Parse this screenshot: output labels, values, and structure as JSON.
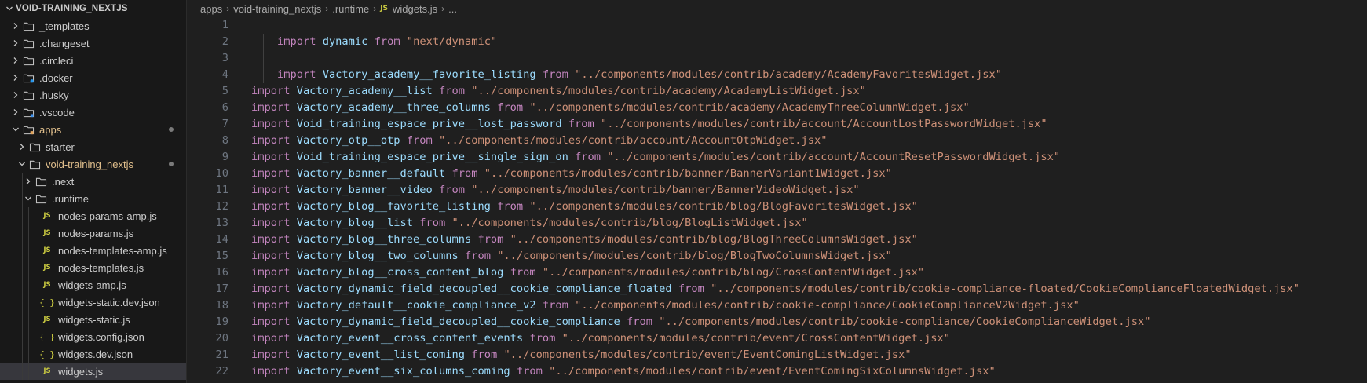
{
  "sidebar": {
    "root_label": "VOID-TRAINING_NEXTJS",
    "items": [
      {
        "label": "_templates",
        "depth": 1,
        "kind": "folder",
        "open": false,
        "modified": false,
        "selected": false,
        "icon": "folder-icon"
      },
      {
        "label": ".changeset",
        "depth": 1,
        "kind": "folder",
        "open": false,
        "modified": false,
        "selected": false,
        "icon": "folder-icon"
      },
      {
        "label": ".circleci",
        "depth": 1,
        "kind": "folder",
        "open": false,
        "modified": false,
        "selected": false,
        "icon": "folder-icon"
      },
      {
        "label": ".docker",
        "depth": 1,
        "kind": "folder",
        "open": false,
        "modified": false,
        "selected": false,
        "icon": "docker-folder-icon"
      },
      {
        "label": ".husky",
        "depth": 1,
        "kind": "folder",
        "open": false,
        "modified": false,
        "selected": false,
        "icon": "folder-icon"
      },
      {
        "label": ".vscode",
        "depth": 1,
        "kind": "folder",
        "open": false,
        "modified": false,
        "selected": false,
        "icon": "vscode-folder-icon"
      },
      {
        "label": "apps",
        "depth": 1,
        "kind": "folder",
        "open": true,
        "modified": true,
        "selected": false,
        "icon": "apps-folder-icon"
      },
      {
        "label": "starter",
        "depth": 2,
        "kind": "folder",
        "open": false,
        "modified": false,
        "selected": false,
        "icon": "folder-icon"
      },
      {
        "label": "void-training_nextjs",
        "depth": 2,
        "kind": "folder",
        "open": true,
        "modified": true,
        "selected": false,
        "icon": "folder-icon"
      },
      {
        "label": ".next",
        "depth": 3,
        "kind": "folder",
        "open": false,
        "modified": false,
        "selected": false,
        "icon": "folder-icon"
      },
      {
        "label": ".runtime",
        "depth": 3,
        "kind": "folder",
        "open": true,
        "modified": false,
        "selected": false,
        "icon": "folder-icon"
      },
      {
        "label": "nodes-params-amp.js",
        "depth": 4,
        "kind": "js",
        "modified": false,
        "selected": false,
        "icon": "js-file-icon"
      },
      {
        "label": "nodes-params.js",
        "depth": 4,
        "kind": "js",
        "modified": false,
        "selected": false,
        "icon": "js-file-icon"
      },
      {
        "label": "nodes-templates-amp.js",
        "depth": 4,
        "kind": "js",
        "modified": false,
        "selected": false,
        "icon": "js-file-icon"
      },
      {
        "label": "nodes-templates.js",
        "depth": 4,
        "kind": "js",
        "modified": false,
        "selected": false,
        "icon": "js-file-icon"
      },
      {
        "label": "widgets-amp.js",
        "depth": 4,
        "kind": "js",
        "modified": false,
        "selected": false,
        "icon": "js-file-icon"
      },
      {
        "label": "widgets-static.dev.json",
        "depth": 4,
        "kind": "json",
        "modified": false,
        "selected": false,
        "icon": "json-file-icon"
      },
      {
        "label": "widgets-static.js",
        "depth": 4,
        "kind": "js",
        "modified": false,
        "selected": false,
        "icon": "js-file-icon"
      },
      {
        "label": "widgets.config.json",
        "depth": 4,
        "kind": "json",
        "modified": false,
        "selected": false,
        "icon": "json-file-icon"
      },
      {
        "label": "widgets.dev.json",
        "depth": 4,
        "kind": "json",
        "modified": false,
        "selected": false,
        "icon": "json-file-icon"
      },
      {
        "label": "widgets.js",
        "depth": 4,
        "kind": "js",
        "modified": false,
        "selected": true,
        "icon": "js-file-icon"
      }
    ]
  },
  "breadcrumb": {
    "parts": [
      "apps",
      "void-training_nextjs",
      ".runtime"
    ],
    "file_badge": "JS",
    "file": "widgets.js",
    "more": "..."
  },
  "code": {
    "keyword": "import",
    "from": "from",
    "lines": [
      {
        "n": "1",
        "type": "blank"
      },
      {
        "n": "2",
        "type": "import",
        "indent": true,
        "name": "dynamic",
        "path": "\"next/dynamic\""
      },
      {
        "n": "3",
        "type": "blank",
        "indent": true
      },
      {
        "n": "4",
        "type": "import",
        "indent": true,
        "name": "Vactory_academy__favorite_listing",
        "path": "\"../components/modules/contrib/academy/AcademyFavoritesWidget.jsx\""
      },
      {
        "n": "5",
        "type": "import",
        "name": "Vactory_academy__list",
        "path": "\"../components/modules/contrib/academy/AcademyListWidget.jsx\""
      },
      {
        "n": "6",
        "type": "import",
        "name": "Vactory_academy__three_columns",
        "path": "\"../components/modules/contrib/academy/AcademyThreeColumnWidget.jsx\""
      },
      {
        "n": "7",
        "type": "import",
        "name": "Void_training_espace_prive__lost_password",
        "path": "\"../components/modules/contrib/account/AccountLostPasswordWidget.jsx\""
      },
      {
        "n": "8",
        "type": "import",
        "name": "Vactory_otp__otp",
        "path": "\"../components/modules/contrib/account/AccountOtpWidget.jsx\""
      },
      {
        "n": "9",
        "type": "import",
        "name": "Void_training_espace_prive__single_sign_on",
        "path": "\"../components/modules/contrib/account/AccountResetPasswordWidget.jsx\""
      },
      {
        "n": "10",
        "type": "import",
        "name": "Vactory_banner__default",
        "path": "\"../components/modules/contrib/banner/BannerVariant1Widget.jsx\""
      },
      {
        "n": "11",
        "type": "import",
        "name": "Vactory_banner__video",
        "path": "\"../components/modules/contrib/banner/BannerVideoWidget.jsx\""
      },
      {
        "n": "12",
        "type": "import",
        "name": "Vactory_blog__favorite_listing",
        "path": "\"../components/modules/contrib/blog/BlogFavoritesWidget.jsx\""
      },
      {
        "n": "13",
        "type": "import",
        "name": "Vactory_blog__list",
        "path": "\"../components/modules/contrib/blog/BlogListWidget.jsx\""
      },
      {
        "n": "14",
        "type": "import",
        "name": "Vactory_blog__three_columns",
        "path": "\"../components/modules/contrib/blog/BlogThreeColumnsWidget.jsx\""
      },
      {
        "n": "15",
        "type": "import",
        "name": "Vactory_blog__two_columns",
        "path": "\"../components/modules/contrib/blog/BlogTwoColumnsWidget.jsx\""
      },
      {
        "n": "16",
        "type": "import",
        "name": "Vactory_blog__cross_content_blog",
        "path": "\"../components/modules/contrib/blog/CrossContentWidget.jsx\""
      },
      {
        "n": "17",
        "type": "import",
        "name": "Vactory_dynamic_field_decoupled__cookie_compliance_floated",
        "path": "\"../components/modules/contrib/cookie-compliance-floated/CookieComplianceFloatedWidget.jsx\""
      },
      {
        "n": "18",
        "type": "import",
        "name": "Vactory_default__cookie_compliance_v2",
        "path": "\"../components/modules/contrib/cookie-compliance/CookieComplianceV2Widget.jsx\""
      },
      {
        "n": "19",
        "type": "import",
        "name": "Vactory_dynamic_field_decoupled__cookie_compliance",
        "path": "\"../components/modules/contrib/cookie-compliance/CookieComplianceWidget.jsx\""
      },
      {
        "n": "20",
        "type": "import",
        "name": "Vactory_event__cross_content_events",
        "path": "\"../components/modules/contrib/event/CrossContentWidget.jsx\""
      },
      {
        "n": "21",
        "type": "import",
        "name": "Vactory_event__list_coming",
        "path": "\"../components/modules/contrib/event/EventComingListWidget.jsx\""
      },
      {
        "n": "22",
        "type": "import",
        "name": "Vactory_event__six_columns_coming",
        "path": "\"../components/modules/contrib/event/EventComingSixColumnsWidget.jsx\""
      }
    ]
  },
  "colors": {
    "keyword": "#c586c0",
    "identifier": "#9cdcfe",
    "string": "#ce9178",
    "modified": "#e2c08d",
    "js_badge": "#cbcb41"
  }
}
